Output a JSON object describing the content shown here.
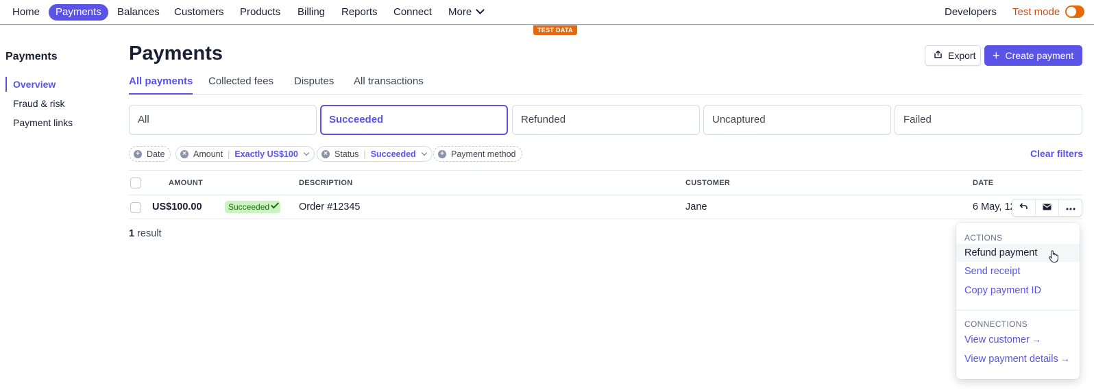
{
  "topnav": {
    "items": [
      {
        "label": "Home"
      },
      {
        "label": "Payments"
      },
      {
        "label": "Balances"
      },
      {
        "label": "Customers"
      },
      {
        "label": "Products"
      },
      {
        "label": "Billing"
      },
      {
        "label": "Reports"
      },
      {
        "label": "Connect"
      },
      {
        "label": "More"
      }
    ],
    "developers": "Developers",
    "test_mode": "Test mode",
    "test_badge": "TEST DATA"
  },
  "sidebar": {
    "title": "Payments",
    "items": [
      {
        "label": "Overview"
      },
      {
        "label": "Fraud & risk"
      },
      {
        "label": "Payment links"
      }
    ]
  },
  "header": {
    "title": "Payments",
    "export_label": "Export",
    "create_label": "Create payment"
  },
  "tabs": [
    {
      "label": "All payments"
    },
    {
      "label": "Collected fees"
    },
    {
      "label": "Disputes"
    },
    {
      "label": "All transactions"
    }
  ],
  "status_cards": [
    {
      "label": "All"
    },
    {
      "label": "Succeeded"
    },
    {
      "label": "Refunded"
    },
    {
      "label": "Uncaptured"
    },
    {
      "label": "Failed"
    }
  ],
  "filters": {
    "date": "Date",
    "amount_label": "Amount",
    "amount_value": "Exactly US$100",
    "status_label": "Status",
    "status_value": "Succeeded",
    "payment_method": "Payment method",
    "clear": "Clear filters"
  },
  "table": {
    "columns": [
      "AMOUNT",
      "DESCRIPTION",
      "CUSTOMER",
      "DATE"
    ],
    "rows": [
      {
        "amount": "US$100.00",
        "status": "Succeeded",
        "description": "Order #12345",
        "customer": "Jane",
        "date": "6 May, 12"
      }
    ],
    "result_count": "1",
    "result_suffix": " result"
  },
  "menu": {
    "actions_title": "ACTIONS",
    "refund": "Refund payment",
    "send_receipt": "Send receipt",
    "copy_id": "Copy payment ID",
    "connections_title": "CONNECTIONS",
    "view_customer": "View customer",
    "view_details": "View payment details"
  },
  "colors": {
    "accent": "#5a53e6",
    "test_mode": "#e8690c",
    "success_bg": "#cbf3c1",
    "success_text": "#1f6a12"
  }
}
